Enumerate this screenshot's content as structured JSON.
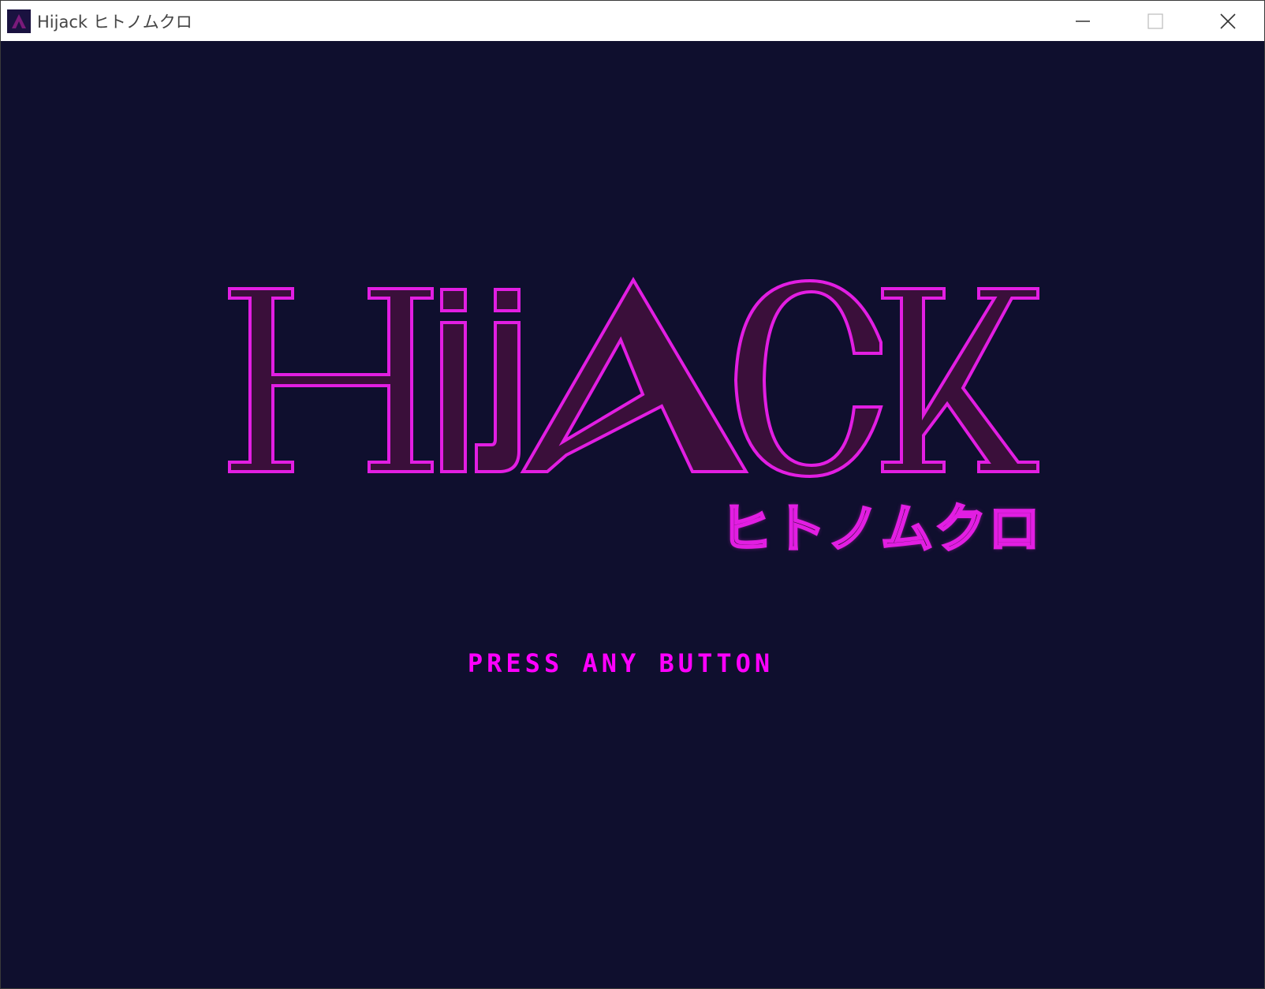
{
  "window": {
    "title": "Hijack ヒトノムクロ",
    "controls": {
      "minimize": "minimize-icon",
      "maximize": "maximize-icon",
      "close": "close-icon"
    }
  },
  "title_screen": {
    "logo_text": "HijACK",
    "logo_subtitle": "ヒトノムクロ",
    "prompt": "PRESS ANY BUTTON"
  },
  "colors": {
    "background": "#0f0f2e",
    "logo_outline": "#e21ee2",
    "logo_fill": "#3a0f3a",
    "prompt": "#ff00ff"
  }
}
